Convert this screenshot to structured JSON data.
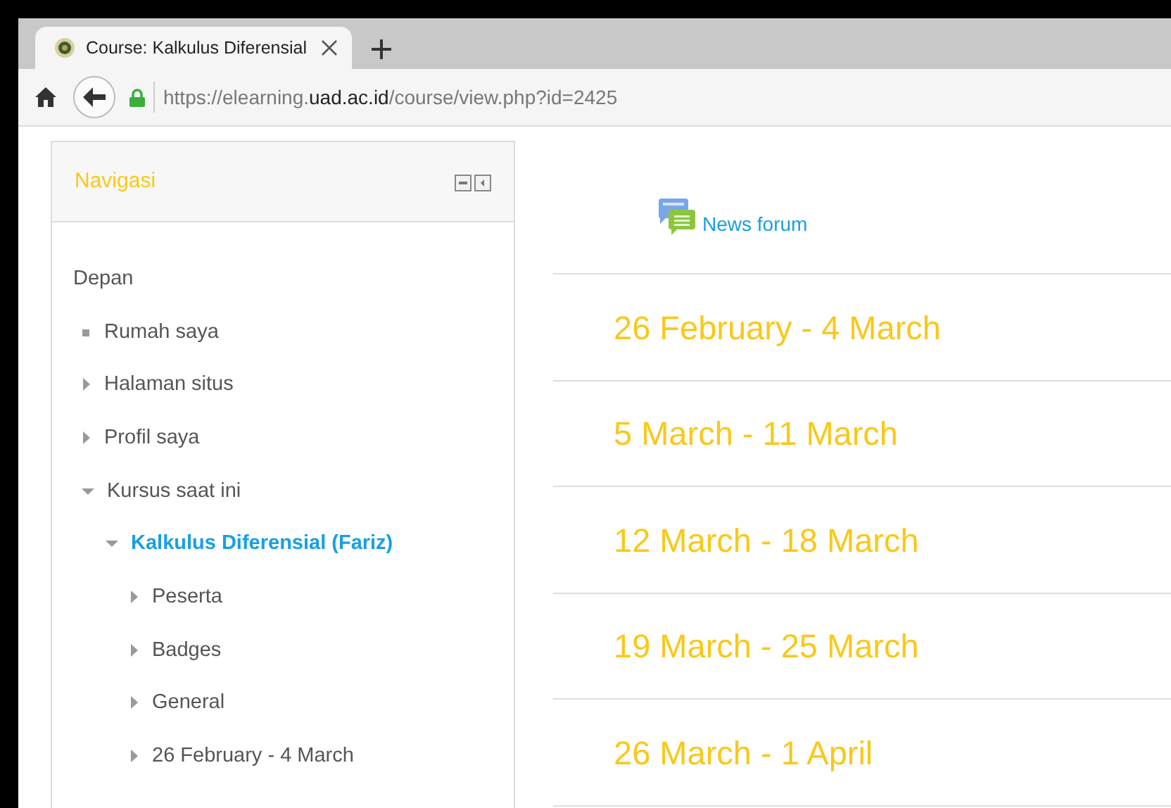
{
  "browser": {
    "tab": {
      "title": "Course: Kalkulus Diferensial",
      "selected": true
    },
    "url": {
      "scheme": "https://elearning.",
      "domain": "uad.ac.id",
      "path": "/course/view.php?id=2425"
    }
  },
  "navigation": {
    "title": "Navigasi",
    "items": [
      {
        "label": "Depan",
        "kind": "text",
        "children": [
          {
            "label": "Rumah saya",
            "kind": "leaf",
            "current": false
          },
          {
            "label": "Halaman situs",
            "kind": "branch",
            "expanded": false,
            "current": false
          },
          {
            "label": "Profil saya",
            "kind": "branch",
            "expanded": false,
            "current": false
          },
          {
            "label": "Kursus saat ini",
            "kind": "branch",
            "expanded": true,
            "current": false,
            "children": [
              {
                "label": "Kalkulus Diferensial (Fariz)",
                "kind": "branch",
                "expanded": true,
                "current": true,
                "children": [
                  {
                    "label": "Peserta",
                    "kind": "branch",
                    "expanded": false,
                    "current": false
                  },
                  {
                    "label": "Badges",
                    "kind": "branch",
                    "expanded": false,
                    "current": false
                  },
                  {
                    "label": "General",
                    "kind": "branch",
                    "expanded": false,
                    "current": false
                  },
                  {
                    "label": "26 February - 4 March",
                    "kind": "branch",
                    "expanded": false,
                    "current": false
                  }
                ]
              }
            ]
          }
        ]
      }
    ]
  },
  "course": {
    "forum": {
      "label": "News forum"
    },
    "sections": [
      {
        "title": "26 February - 4 March"
      },
      {
        "title": "5 March - 11 March"
      },
      {
        "title": "12 March - 18 March"
      },
      {
        "title": "19 March - 25 March"
      },
      {
        "title": "26 March - 1 April"
      }
    ]
  }
}
